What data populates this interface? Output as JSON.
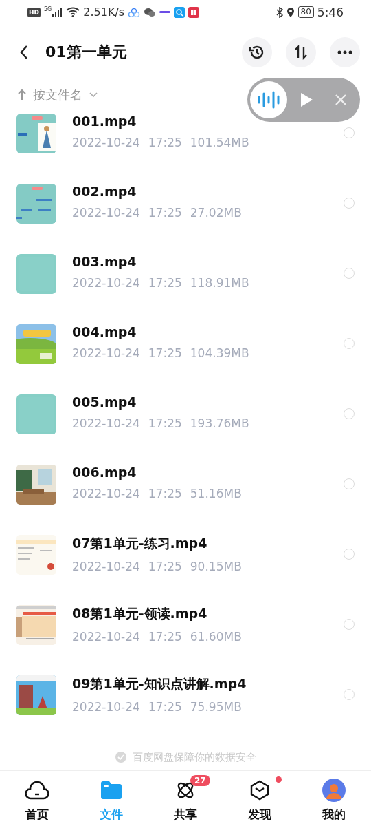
{
  "status_bar": {
    "hd": "HD",
    "network": "5G",
    "speed": "2.51K/s",
    "battery": "80",
    "time": "5:46"
  },
  "header": {
    "title": "01第一单元"
  },
  "sort": {
    "label": "按文件名"
  },
  "player": {
    "playing": false
  },
  "files": [
    {
      "name": "001.mp4",
      "date": "2022-10-24",
      "time": "17:25",
      "size": "101.54MB",
      "selected": false
    },
    {
      "name": "002.mp4",
      "date": "2022-10-24",
      "time": "17:25",
      "size": "27.02MB",
      "selected": false
    },
    {
      "name": "003.mp4",
      "date": "2022-10-24",
      "time": "17:25",
      "size": "118.91MB",
      "selected": false
    },
    {
      "name": "004.mp4",
      "date": "2022-10-24",
      "time": "17:25",
      "size": "104.39MB",
      "selected": false
    },
    {
      "name": "005.mp4",
      "date": "2022-10-24",
      "time": "17:25",
      "size": "193.76MB",
      "selected": false
    },
    {
      "name": "006.mp4",
      "date": "2022-10-24",
      "time": "17:25",
      "size": "51.16MB",
      "selected": false
    },
    {
      "name": "07第1单元-练习.mp4",
      "date": "2022-10-24",
      "time": "17:25",
      "size": "90.15MB",
      "selected": false
    },
    {
      "name": "08第1单元-领读.mp4",
      "date": "2022-10-24",
      "time": "17:25",
      "size": "61.60MB",
      "selected": false
    },
    {
      "name": "09第1单元-知识点讲解.mp4",
      "date": "2022-10-24",
      "time": "17:25",
      "size": "75.95MB",
      "selected": false
    }
  ],
  "footer_note": "百度网盘保障你的数据安全",
  "tabs": [
    {
      "label": "首页",
      "kind": "home",
      "selected": false
    },
    {
      "label": "文件",
      "kind": "files",
      "selected": true
    },
    {
      "label": "共享",
      "kind": "share",
      "selected": false,
      "badge": "27"
    },
    {
      "label": "发现",
      "kind": "discover",
      "selected": false,
      "dot": true
    },
    {
      "label": "我的",
      "kind": "me",
      "selected": false
    }
  ]
}
